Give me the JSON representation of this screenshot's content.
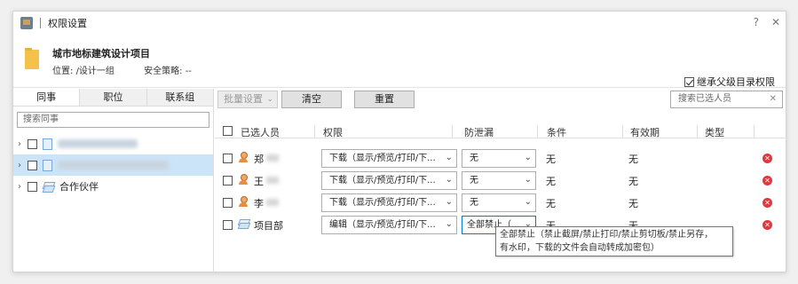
{
  "window": {
    "title": "权限设置",
    "help": "?",
    "close": "✕"
  },
  "project": {
    "name": "城市地标建筑设计项目",
    "location_label": "位置:",
    "location_value": "/设计一组",
    "policy_label": "安全策略:",
    "policy_value": "--",
    "inherit_label": "继承父级目录权限",
    "inherit_checked": true
  },
  "left": {
    "tabs": [
      "同事",
      "职位",
      "联系组"
    ],
    "active_tab": 0,
    "search_placeholder": "搜索同事",
    "tree": [
      {
        "label": "",
        "redacted": true,
        "selected": false
      },
      {
        "label": "",
        "redacted": true,
        "selected": true
      },
      {
        "label": "合作伙伴",
        "redacted": false,
        "selected": false
      }
    ]
  },
  "toolbar": {
    "batch_label": "批量设置",
    "clear_label": "清空",
    "reset_label": "重置",
    "search_placeholder": "搜索已选人员"
  },
  "table": {
    "headers": [
      "已选人员",
      "权限",
      "防泄漏",
      "条件",
      "有效期",
      "类型"
    ],
    "rows": [
      {
        "name": "郑",
        "type": "person",
        "permission": "下载（显示/预览/打印/下...",
        "dlp": "无",
        "condition": "无",
        "validity": "无"
      },
      {
        "name": "王",
        "type": "person",
        "permission": "下载（显示/预览/打印/下...",
        "dlp": "无",
        "condition": "无",
        "validity": "无"
      },
      {
        "name": "李",
        "type": "person",
        "permission": "下载（显示/预览/打印/下...",
        "dlp": "无",
        "condition": "无",
        "validity": "无"
      },
      {
        "name": "项目部",
        "type": "dept",
        "permission": "编辑（显示/预览/打印/下...",
        "dlp": "全部禁止（...",
        "condition": "无",
        "validity": "无"
      }
    ]
  },
  "tooltip": {
    "line1": "全部禁止（禁止截屏/禁止打印/禁止剪切板/禁止另存，",
    "line2": "有水印，下载的文件会自动转成加密包）"
  },
  "colors": {
    "selection": "#cce4f7",
    "delete": "#e0383e",
    "focus": "#0078d7"
  }
}
